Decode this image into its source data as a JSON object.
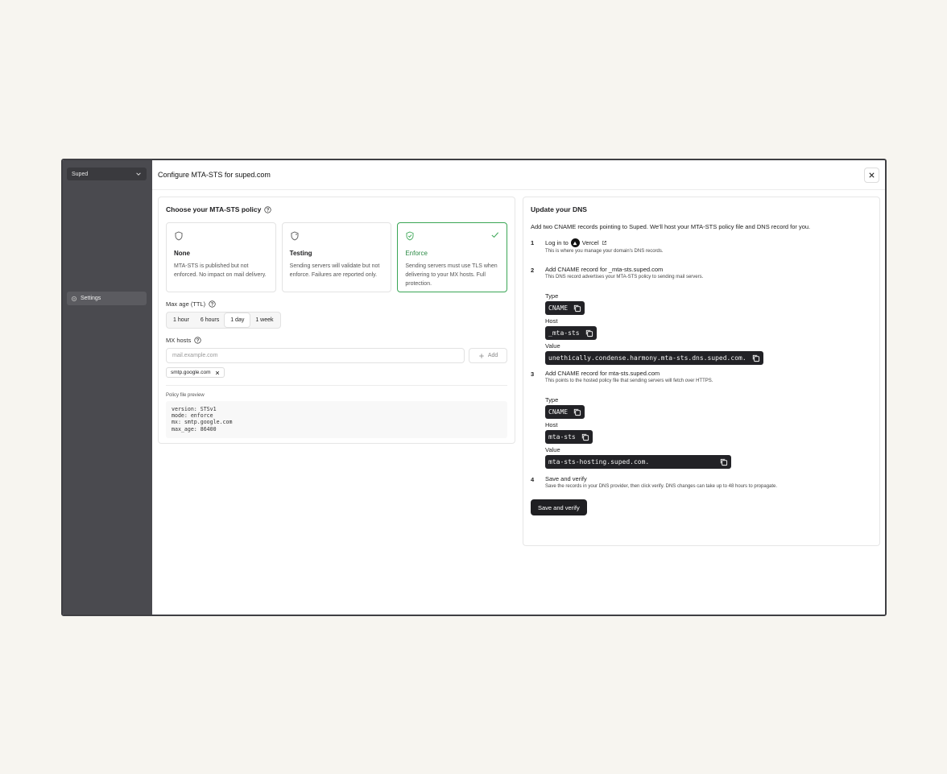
{
  "sidebar": {
    "workspace": "Suped",
    "nav_settings": "Settings"
  },
  "modal": {
    "title": "Configure MTA-STS for suped.com"
  },
  "policy": {
    "heading": "Choose your MTA-STS policy",
    "cards": [
      {
        "title": "None",
        "desc": "MTA-STS is published but not enforced. No impact on mail delivery."
      },
      {
        "title": "Testing",
        "desc": "Sending servers will validate but not enforce. Failures are reported only."
      },
      {
        "title": "Enforce",
        "desc": "Sending servers must use TLS when delivering to your MX hosts. Full protection."
      }
    ],
    "selected": "Enforce",
    "accent_color": "#3aa655",
    "max_age_label": "Max age (TTL)",
    "ttl_options": [
      "1 hour",
      "6 hours",
      "1 day",
      "1 week"
    ],
    "ttl_selected": "1 day",
    "mx_label": "MX hosts",
    "mx_placeholder": "mail.example.com",
    "add_label": "Add",
    "mx_chip": "smtp.google.com",
    "preview_label": "Policy file preview",
    "preview_text": "version: STSv1\nmode: enforce\nmx: smtp.google.com\nmax_age: 86400"
  },
  "dns": {
    "heading": "Update your DNS",
    "intro": "Add two CNAME records pointing to Suped. We'll host your MTA-STS policy file and DNS record for you.",
    "step1": {
      "num": "1",
      "prefix": "Log in to",
      "provider": "Vercel",
      "desc": "This is where you manage your domain's DNS records."
    },
    "step2": {
      "num": "2",
      "title": "Add CNAME record for _mta-sts.suped.com",
      "desc": "This DNS record advertises your MTA-STS policy to sending mail servers.",
      "type_label": "Type",
      "type": "CNAME",
      "host_label": "Host",
      "host": "_mta-sts",
      "value_label": "Value",
      "value": "unethically.condense.harmony.mta-sts.dns.suped.com."
    },
    "step3": {
      "num": "3",
      "title": "Add CNAME record for mta-sts.suped.com",
      "desc": "This points to the hosted policy file that sending servers will fetch over HTTPS.",
      "type_label": "Type",
      "type": "CNAME",
      "host_label": "Host",
      "host": "mta-sts",
      "value_label": "Value",
      "value": "mta-sts-hosting.suped.com."
    },
    "step4": {
      "num": "4",
      "title": "Save and verify",
      "desc": "Save the records in your DNS provider, then click verify. DNS changes can take up to 48 hours to propagate."
    },
    "button": "Save and verify"
  }
}
